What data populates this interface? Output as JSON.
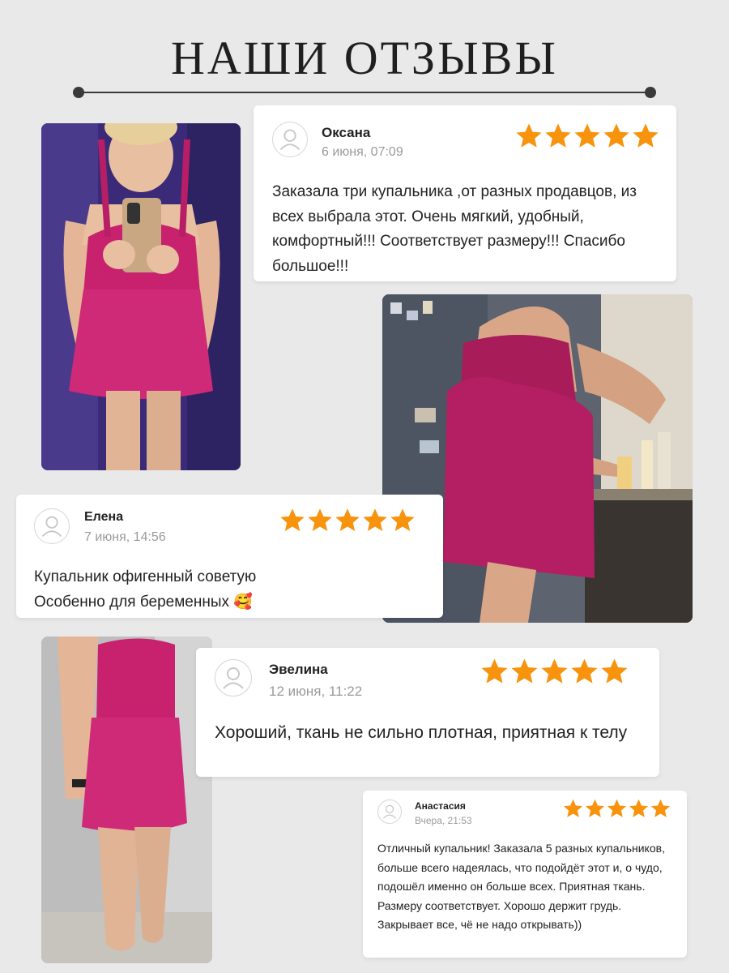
{
  "title": "НАШИ ОТЗЫВЫ",
  "colors": {
    "star": "#f7930d",
    "dress": "#c8226f",
    "background": "#e9e9ea"
  },
  "reviews": [
    {
      "name": "Оксана",
      "date": "6 июня, 07:09",
      "rating": 5,
      "text": "Заказала три купальника ,от разных продавцов, из всех выбрала этот. Очень мягкий, удобный, комфортный!!! Соответствует размеру!!! Спасибо большое!!!"
    },
    {
      "name": "Елена",
      "date": "7 июня, 14:56",
      "rating": 5,
      "text_line1": "Купальник офигенный советую",
      "text_line2": "Особенно для беременных",
      "emoji": "🥰"
    },
    {
      "name": "Эвелина",
      "date": "12 июня, 11:22",
      "rating": 5,
      "text": "Хороший, ткань не сильно плотная, приятная к телу"
    },
    {
      "name": "Анастасия",
      "date": "Вчера, 21:53",
      "rating": 5,
      "text": "Отличный купальник! Заказала 5 разных купальников, больше всего надеялась, что подойдёт этот и, о чудо, подошёл именно он больше всех. Приятная ткань. Размеру соответствует. Хорошо держит грудь. Закрывает все, чё не надо открывать))"
    }
  ],
  "photos": [
    {
      "icon": "customer-photo-1"
    },
    {
      "icon": "customer-photo-2"
    },
    {
      "icon": "customer-photo-3"
    }
  ]
}
